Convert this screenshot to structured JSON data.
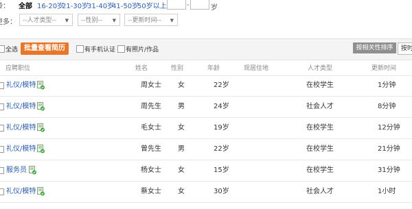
{
  "filters": {
    "age_label": "年龄：",
    "age_options": [
      "全部",
      "16-20岁",
      "21-30岁",
      "31-40岁",
      "41-50岁",
      "50岁以上"
    ],
    "age_selected": 0,
    "range_dash": "-",
    "range_unit": "岁",
    "more_label": "更多：",
    "selects": [
      "--人才类型--",
      "--性别--",
      "--更新时间--"
    ]
  },
  "toolbar": {
    "select_all": "全选",
    "batch_view": "批量查看简历",
    "phone_verified": "有手机认证",
    "has_photo": "有照片/作品",
    "sort_relevance": "按相关性排序",
    "sort_time": "按时"
  },
  "table": {
    "headers": [
      "应聘职位",
      "姓名",
      "性别",
      "年龄",
      "现居住地",
      "人才类型",
      "更新时间"
    ],
    "rows": [
      {
        "job": "礼仪/模特",
        "name": "周女士",
        "gender": "女",
        "age": "22岁",
        "location": "",
        "type": "在校学生",
        "updated": "1分钟"
      },
      {
        "job": "礼仪/模特",
        "name": "周先生",
        "gender": "男",
        "age": "24岁",
        "location": "",
        "type": "社会人才",
        "updated": "8分钟"
      },
      {
        "job": "礼仪/模特",
        "name": "毛女士",
        "gender": "女",
        "age": "19岁",
        "location": "",
        "type": "在校学生",
        "updated": "12分钟"
      },
      {
        "job": "礼仪/模特",
        "name": "曾先生",
        "gender": "男",
        "age": "22岁",
        "location": "",
        "type": "在校学生",
        "updated": "21分钟"
      },
      {
        "job": "服务员",
        "name": "杨女士",
        "gender": "女",
        "age": "15岁",
        "location": "",
        "type": "在校学生",
        "updated": "31分钟"
      },
      {
        "job": "礼仪/模特",
        "name": "蔡女士",
        "gender": "女",
        "age": "30岁",
        "location": "",
        "type": "社会人才",
        "updated": "1小时"
      }
    ]
  },
  "colors": {
    "link": "#2a5db0",
    "accent_button": "#e8772a",
    "sort_button": "#8f8f8f",
    "icon_green": "#3da33d"
  }
}
